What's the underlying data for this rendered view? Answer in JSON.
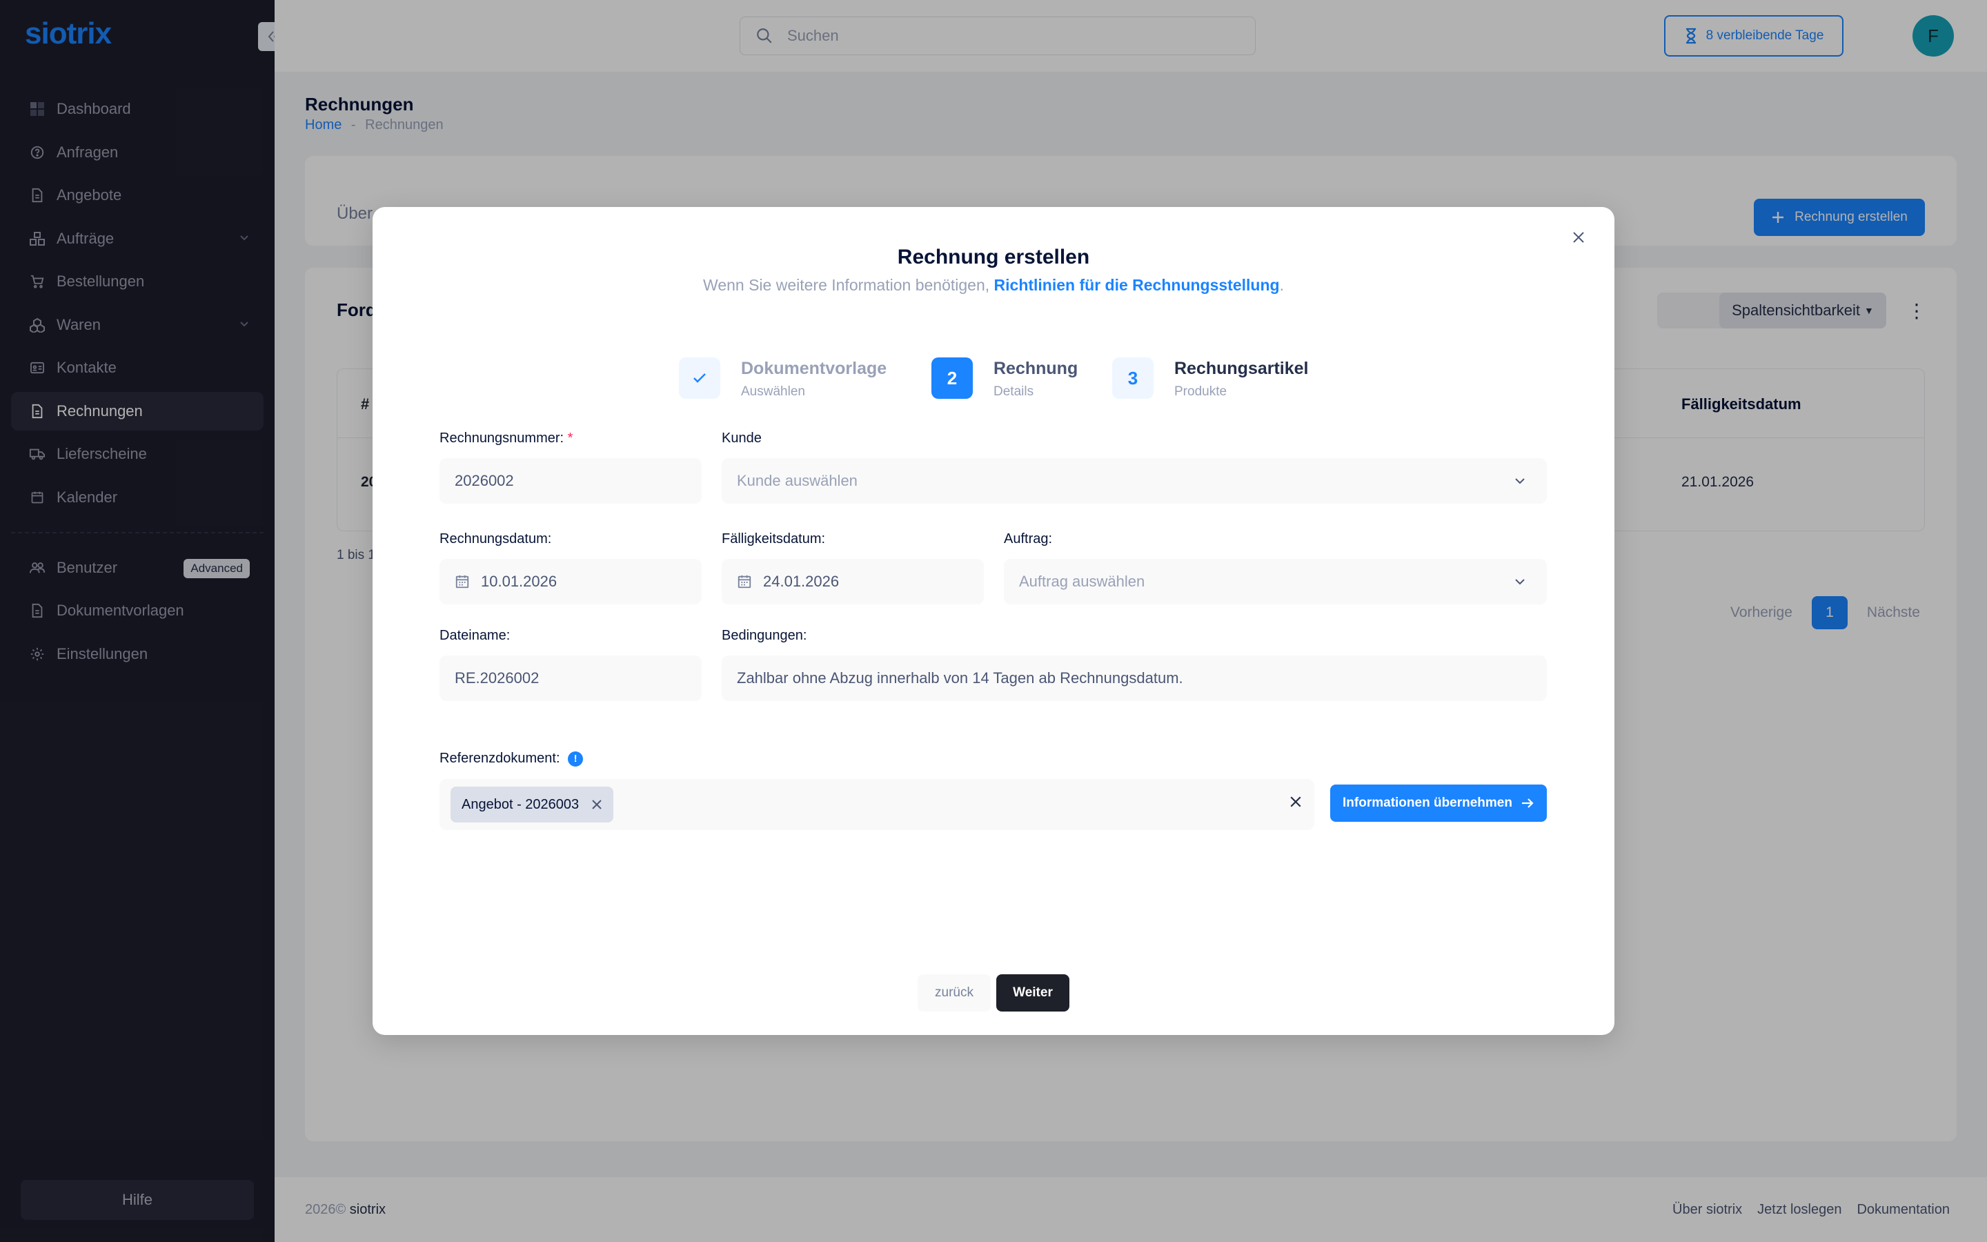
{
  "brand": {
    "logo": "siotrix"
  },
  "sidebar": {
    "items": [
      {
        "label": "Dashboard"
      },
      {
        "label": "Anfragen"
      },
      {
        "label": "Angebote"
      },
      {
        "label": "Aufträge"
      },
      {
        "label": "Bestellungen"
      },
      {
        "label": "Waren"
      },
      {
        "label": "Kontakte"
      },
      {
        "label": "Rechnungen"
      },
      {
        "label": "Lieferscheine"
      },
      {
        "label": "Kalender"
      }
    ],
    "secondary": [
      {
        "label": "Benutzer",
        "badge": "Advanced"
      },
      {
        "label": "Dokumentvorlagen"
      },
      {
        "label": "Einstellungen"
      }
    ],
    "help": "Hilfe"
  },
  "topbar": {
    "search_placeholder": "Suchen",
    "trial": "8 verbleibende Tage",
    "avatar": "F"
  },
  "page": {
    "title": "Rechnungen",
    "breadcrumb_home": "Home",
    "breadcrumb_sep": "-",
    "breadcrumb_current": "Rechnungen",
    "tab_partial": "Über",
    "create_button": "Rechnung erstellen",
    "card_title_partial": "Ford",
    "columns_button": "Spaltensichtbarkeit",
    "table": {
      "hash": "#",
      "due_header": "Fälligkeitsdatum",
      "row_id_partial": "20",
      "row_due": "21.01.2026"
    },
    "info_partial": "1 bis 1 v",
    "pager": {
      "prev": "Vorherige",
      "current": "1",
      "next": "Nächste"
    }
  },
  "footer": {
    "year": "2026©",
    "brand": "siotrix",
    "links": [
      "Über siotrix",
      "Jetzt loslegen",
      "Dokumentation"
    ]
  },
  "modal": {
    "title": "Rechnung erstellen",
    "subtitle_text": "Wenn Sie weitere Information benötigen, ",
    "subtitle_link": "Richtlinien für die Rechnungsstellung",
    "subtitle_end": ".",
    "steps": [
      {
        "number": "",
        "label": "Dokumentvorlage",
        "desc": "Auswählen"
      },
      {
        "number": "2",
        "label": "Rechnung",
        "desc": "Details"
      },
      {
        "number": "3",
        "label": "Rechungsartikel",
        "desc": "Produkte"
      }
    ],
    "fields": {
      "invoice_number_label": "Rechnungsnummer:",
      "invoice_number_required": "*",
      "invoice_number_value": "2026002",
      "customer_label": "Kunde",
      "customer_placeholder": "Kunde auswählen",
      "invoice_date_label": "Rechnungsdatum:",
      "invoice_date_value": "10.01.2026",
      "due_date_label": "Fälligkeitsdatum:",
      "due_date_value": "24.01.2026",
      "order_label": "Auftrag:",
      "order_placeholder": "Auftrag auswählen",
      "filename_label": "Dateiname:",
      "filename_value": "RE.2026002",
      "terms_label": "Bedingungen:",
      "terms_value": "Zahlbar ohne Abzug innerhalb von 14 Tagen ab Rechnungsdatum.",
      "reference_label": "Referenzdokument:",
      "reference_info": "!",
      "reference_tag": "Angebot - 2026003"
    },
    "apply_button": "Informationen übernehmen",
    "back_button": "zurück",
    "next_button": "Weiter"
  },
  "colors": {
    "accent": "#1b84ff",
    "sidebar_bg": "#1e1e2d",
    "dark_button": "#1e2129"
  }
}
